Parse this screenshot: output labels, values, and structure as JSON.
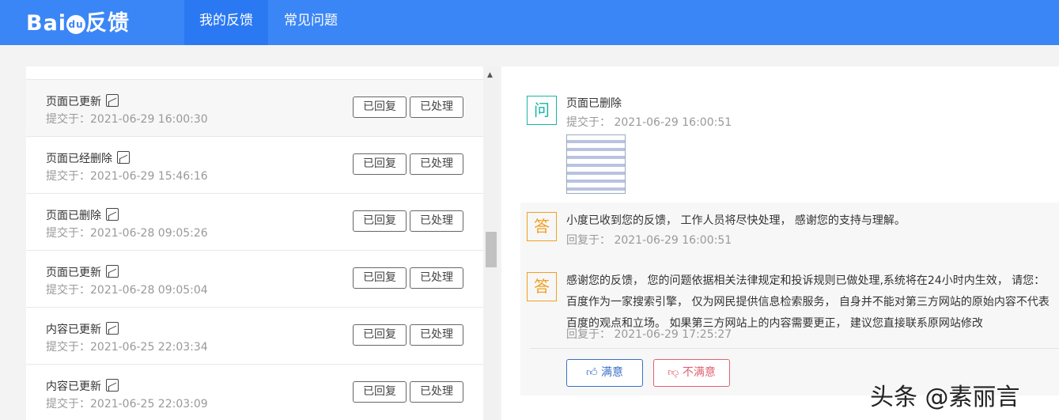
{
  "header": {
    "logo": "Bai",
    "logo_paw": "du",
    "logo_suffix": "反馈",
    "tabs": [
      {
        "label": "我的反馈",
        "active": true
      },
      {
        "label": "常见问题",
        "active": false
      }
    ]
  },
  "list": [
    {
      "title": "页面已更新",
      "time": "提交于：2021-06-29 16:00:30",
      "status1": "已回复",
      "status2": "已处理"
    },
    {
      "title": "页面已经删除",
      "time": "提交于：2021-06-29 15:46:16",
      "status1": "已回复",
      "status2": "已处理"
    },
    {
      "title": "页面已删除",
      "time": "提交于：2021-06-28 09:05:26",
      "status1": "已回复",
      "status2": "已处理"
    },
    {
      "title": "页面已更新",
      "time": "提交于：2021-06-28 09:05:04",
      "status1": "已回复",
      "status2": "已处理"
    },
    {
      "title": "内容已更新",
      "time": "提交于：2021-06-25 22:03:34",
      "status1": "已回复",
      "status2": "已处理"
    },
    {
      "title": "内容已更新",
      "time": "提交于：2021-06-25 22:03:09",
      "status1": "已回复",
      "status2": "已处理"
    }
  ],
  "detail": {
    "q_badge": "问",
    "question": "页面已删除",
    "q_time": "提交于：  2021-06-29 16:00:51",
    "answers": [
      {
        "badge": "答",
        "text": "小度已收到您的反馈， 工作人员将尽快处理， 感谢您的支持与理解。",
        "time": "回复于：  2021-06-29 16:00:51"
      },
      {
        "badge": "答",
        "text": "感谢您的反馈， 您的问题依据相关法律规定和投诉规则已做处理,系统将在24小时内生效， 请您：  百度作为一家搜索引擎， 仅为网民提供信息检索服务， 自身并不能对第三方网站的原始内容不代表百度的观点和立场。 如果第三方网站上的内容需要更正， 建议您直接联系原网站修改",
        "time": "回复于：  2021-06-29 17:25:27"
      }
    ],
    "satisfied": "满意",
    "unsatisfied": "不满意"
  },
  "watermark": "头条 @素丽言"
}
